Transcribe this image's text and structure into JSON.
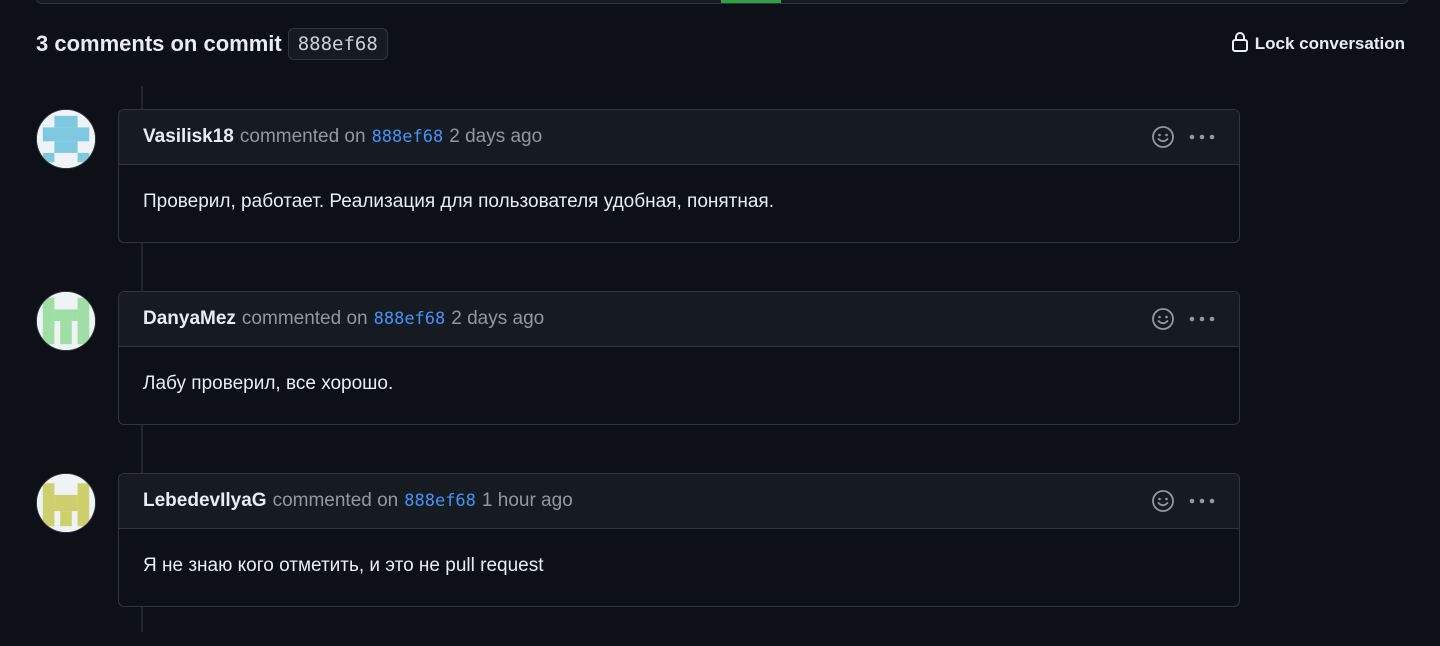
{
  "header": {
    "title": "3 comments on commit",
    "sha": "888ef68",
    "lock_label": "Lock conversation"
  },
  "comments": [
    {
      "author": "Vasilisk18",
      "verb": "commented on",
      "sha": "888ef68",
      "time": "2 days ago",
      "body": "Проверил, работает. Реализация для пользователя удобная, понятная.",
      "avatar_color": "#7fc9e0"
    },
    {
      "author": "DanyaMez",
      "verb": "commented on",
      "sha": "888ef68",
      "time": "2 days ago",
      "body": "Лабу проверил, все хорошо.",
      "avatar_color": "#9fdfa6"
    },
    {
      "author": "LebedevIlyaG",
      "verb": "commented on",
      "sha": "888ef68",
      "time": "1 hour ago",
      "body": "Я не знаю кого отметить, и это не pull request",
      "avatar_color": "#cfcf6e"
    }
  ],
  "icons": {
    "lock": "lock-icon",
    "smiley": "smiley-icon",
    "kebab": "kebab-horizontal-icon"
  }
}
